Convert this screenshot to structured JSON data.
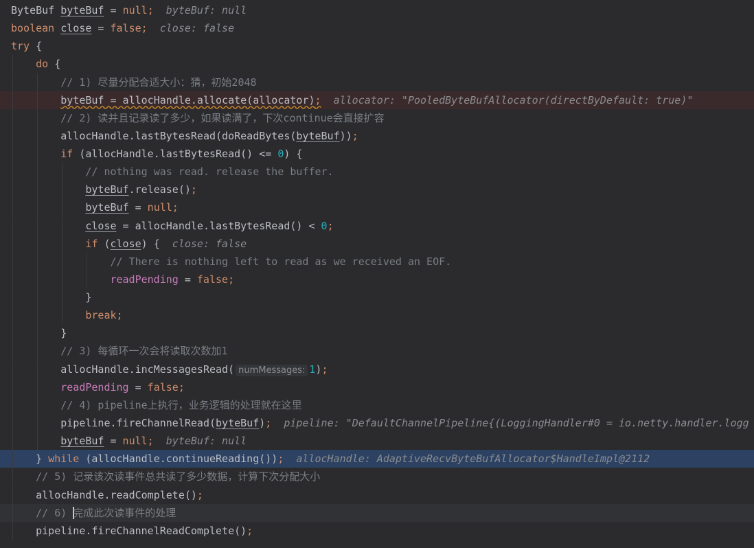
{
  "colors": {
    "background": "#2b2b2d",
    "keyword": "#cf8e6d",
    "number": "#2aacb8",
    "field": "#c77dbb",
    "comment": "#7a7e85",
    "breakpoint_line": "#3b2a2c",
    "execution_line": "#2d4262"
  },
  "lines": [
    {
      "indent": 0,
      "tokens": [
        [
          "t",
          "ByteBuf "
        ],
        [
          "ul",
          "byteBuf"
        ],
        [
          "t",
          " = "
        ],
        [
          "kw",
          "null"
        ],
        [
          "semi",
          ";"
        ],
        [
          "hint",
          "  byteBuf: null"
        ]
      ]
    },
    {
      "indent": 0,
      "tokens": [
        [
          "kw",
          "boolean "
        ],
        [
          "ul",
          "close"
        ],
        [
          "t",
          " = "
        ],
        [
          "kw",
          "false"
        ],
        [
          "semi",
          ";"
        ],
        [
          "hint",
          "  close: false"
        ]
      ]
    },
    {
      "indent": 0,
      "tokens": [
        [
          "kw",
          "try"
        ],
        [
          "t",
          " {"
        ]
      ]
    },
    {
      "indent": 1,
      "tokens": [
        [
          "kw",
          "do"
        ],
        [
          "t",
          " {"
        ]
      ]
    },
    {
      "indent": 2,
      "tokens": [
        [
          "cm",
          "// 1) 尽量分配合适大小：猜，初始2048"
        ]
      ]
    },
    {
      "indent": 2,
      "state": "breakpoint",
      "tokens": [
        [
          "ulwarn",
          "byteBuf"
        ],
        [
          "warn",
          " = allocHandle.allocate(allocator)"
        ],
        [
          "semiwarn",
          ";"
        ],
        [
          "hint",
          "  allocator: \"PooledByteBufAllocator(directByDefault: true)\""
        ]
      ]
    },
    {
      "indent": 2,
      "tokens": [
        [
          "cm",
          "// 2) 读并且记录读了多少，如果读满了，下次continue会直接扩容"
        ]
      ]
    },
    {
      "indent": 2,
      "tokens": [
        [
          "t",
          "allocHandle.lastBytesRead(doReadBytes("
        ],
        [
          "ul",
          "byteBuf"
        ],
        [
          "t",
          "))"
        ],
        [
          "semi",
          ";"
        ]
      ]
    },
    {
      "indent": 2,
      "tokens": [
        [
          "kw",
          "if"
        ],
        [
          "t",
          " (allocHandle.lastBytesRead() <= "
        ],
        [
          "num",
          "0"
        ],
        [
          "t",
          ") {"
        ]
      ]
    },
    {
      "indent": 3,
      "tokens": [
        [
          "cm",
          "// nothing was read. release the buffer."
        ]
      ]
    },
    {
      "indent": 3,
      "tokens": [
        [
          "ul",
          "byteBuf"
        ],
        [
          "t",
          ".release()"
        ],
        [
          "semi",
          ";"
        ]
      ]
    },
    {
      "indent": 3,
      "tokens": [
        [
          "ul",
          "byteBuf"
        ],
        [
          "t",
          " = "
        ],
        [
          "kw",
          "null"
        ],
        [
          "semi",
          ";"
        ]
      ]
    },
    {
      "indent": 3,
      "tokens": [
        [
          "ul",
          "close"
        ],
        [
          "t",
          " = allocHandle.lastBytesRead() < "
        ],
        [
          "num",
          "0"
        ],
        [
          "semi",
          ";"
        ]
      ]
    },
    {
      "indent": 3,
      "tokens": [
        [
          "kw",
          "if"
        ],
        [
          "t",
          " ("
        ],
        [
          "ul",
          "close"
        ],
        [
          "t",
          ") {"
        ],
        [
          "hint",
          "  close: false"
        ]
      ]
    },
    {
      "indent": 4,
      "tokens": [
        [
          "cm",
          "// There is nothing left to read as we received an EOF."
        ]
      ]
    },
    {
      "indent": 4,
      "tokens": [
        [
          "field",
          "readPending"
        ],
        [
          "t",
          " = "
        ],
        [
          "kw",
          "false"
        ],
        [
          "semi",
          ";"
        ]
      ]
    },
    {
      "indent": 3,
      "tokens": [
        [
          "t",
          "}"
        ]
      ]
    },
    {
      "indent": 3,
      "tokens": [
        [
          "kw",
          "break"
        ],
        [
          "semi",
          ";"
        ]
      ]
    },
    {
      "indent": 2,
      "tokens": [
        [
          "t",
          "}"
        ]
      ]
    },
    {
      "indent": 2,
      "tokens": [
        [
          "cm",
          "// 3) 每循环一次会将读取次数加1"
        ]
      ]
    },
    {
      "indent": 2,
      "tokens": [
        [
          "t",
          "allocHandle.incMessagesRead("
        ],
        [
          "hintbox",
          "numMessages:"
        ],
        [
          "num",
          "1"
        ],
        [
          "t",
          ")"
        ],
        [
          "semi",
          ";"
        ]
      ]
    },
    {
      "indent": 2,
      "tokens": [
        [
          "field",
          "readPending"
        ],
        [
          "t",
          " = "
        ],
        [
          "kw",
          "false"
        ],
        [
          "semi",
          ";"
        ]
      ]
    },
    {
      "indent": 2,
      "tokens": [
        [
          "cm",
          "// 4) pipeline上执行，业务逻辑的处理就在这里"
        ]
      ]
    },
    {
      "indent": 2,
      "tokens": [
        [
          "t",
          "pipeline.fireChannelRead("
        ],
        [
          "ul",
          "byteBuf"
        ],
        [
          "t",
          ")"
        ],
        [
          "semi",
          ";"
        ],
        [
          "hint",
          "  pipeline: \"DefaultChannelPipeline{(LoggingHandler#0 = io.netty.handler.logg"
        ]
      ]
    },
    {
      "indent": 2,
      "tokens": [
        [
          "ul",
          "byteBuf"
        ],
        [
          "t",
          " = "
        ],
        [
          "kw",
          "null"
        ],
        [
          "semi",
          ";"
        ],
        [
          "hint",
          "  byteBuf: null"
        ]
      ]
    },
    {
      "indent": 1,
      "state": "exec",
      "tokens": [
        [
          "t",
          "} "
        ],
        [
          "kw",
          "while"
        ],
        [
          "t",
          " (allocHandle.continueReading())"
        ],
        [
          "semi",
          ";"
        ],
        [
          "hint",
          "  allocHandle: AdaptiveRecvByteBufAllocator$HandleImpl@2112"
        ]
      ]
    },
    {
      "indent": 1,
      "tokens": [
        [
          "cm",
          "// 5) 记录该次读事件总共读了多少数据，计算下次分配大小"
        ]
      ]
    },
    {
      "indent": 1,
      "tokens": [
        [
          "t",
          "allocHandle.readComplete()"
        ],
        [
          "semi",
          ";"
        ]
      ]
    },
    {
      "indent": 1,
      "state": "caret",
      "tokens": [
        [
          "cm",
          "// 6) "
        ],
        [
          "caret",
          ""
        ],
        [
          "cm",
          "完成此次读事件的处理"
        ]
      ]
    },
    {
      "indent": 1,
      "tokens": [
        [
          "t",
          "pipeline.fireChannelReadComplete()"
        ],
        [
          "semi",
          ";"
        ]
      ]
    }
  ]
}
